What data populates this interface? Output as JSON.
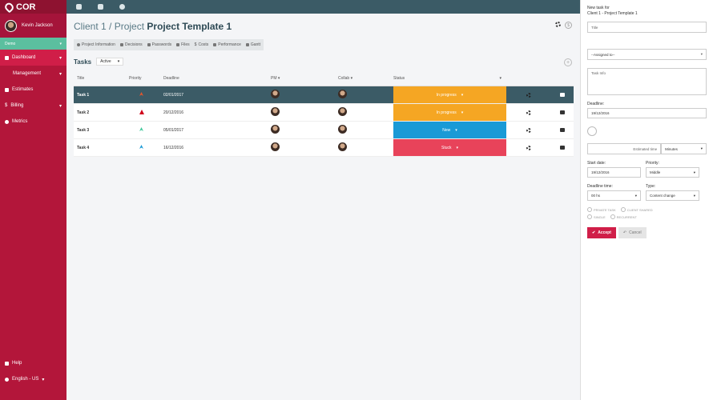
{
  "brand": {
    "name": "COR"
  },
  "user": {
    "name": "Kevin Jackson"
  },
  "workspace": {
    "name": "Demo"
  },
  "nav": {
    "items": [
      {
        "label": "Dashboard",
        "active": true
      },
      {
        "label": "Management",
        "sub": true
      },
      {
        "label": "Estimates"
      },
      {
        "label": "Billing"
      },
      {
        "label": "Metrics"
      }
    ],
    "bottom": [
      {
        "label": "Help"
      },
      {
        "label": "English - US"
      }
    ]
  },
  "header": {
    "breadcrumb_client": "Client 1 / Project",
    "breadcrumb_project": "Project Template 1"
  },
  "tabs": [
    "Project Information",
    "Decisions",
    "Passwords",
    "Files",
    "Costs",
    "Performance",
    "Gantt"
  ],
  "tasks": {
    "title": "Tasks",
    "filter": "Active",
    "columns": {
      "title": "Title",
      "priority": "Priority",
      "deadline": "Deadline",
      "pm": "PM",
      "collab": "Collab",
      "status": "Status"
    },
    "rows": [
      {
        "title": "Task 1",
        "deadline": "02/01/2017",
        "status": "In progress",
        "priority_color": "#e8562a",
        "status_color": "#f5a623",
        "selected": true
      },
      {
        "title": "Task 2",
        "deadline": "20/12/2016",
        "status": "In progress",
        "priority_color": "#d0021b",
        "status_color": "#f5a623"
      },
      {
        "title": "Task 3",
        "deadline": "05/01/2017",
        "status": "New",
        "priority_color": "#3ec79a",
        "status_color": "#1a9ad6"
      },
      {
        "title": "Task 4",
        "deadline": "16/12/2016",
        "status": "Stuck",
        "priority_color": "#1a9ad6",
        "status_color": "#e8435a"
      }
    ]
  },
  "panel": {
    "heading_line1": "New task for",
    "heading_line2": "Client 1 - Project Template 1",
    "title_placeholder": "Title",
    "assigned_value": "--Assigned to--",
    "info_placeholder": "Task Info",
    "deadline_label": "Deadline:",
    "deadline_value": "19/12/2016",
    "estimated_placeholder": "Estimated time",
    "estimated_unit": "Minutes",
    "start_label": "Start date:",
    "start_value": "19/12/2016",
    "priority_label": "Priority:",
    "priority_value": "Middle",
    "deadline_time_label": "Deadline time:",
    "deadline_time_value": "00 hs",
    "type_label": "Type:",
    "type_value": "Content change",
    "radios": [
      "PRIVATE TASK",
      "CLIENT SHARED",
      "SINGLE",
      "RECURRENT"
    ],
    "accept": "Accept",
    "cancel": "Cancel"
  }
}
